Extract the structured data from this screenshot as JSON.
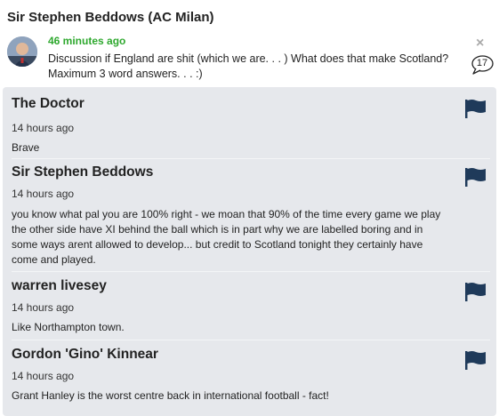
{
  "post": {
    "author": "Sir Stephen Beddows (AC Milan)",
    "time": "46 minutes ago",
    "text": "Discussion if England are shit (which we are. . . ) What does that make Scotland? Maximum 3 word answers. . . :)",
    "close_icon": "×",
    "comment_count": "17"
  },
  "replies": [
    {
      "name": "The Doctor",
      "time": "14 hours ago",
      "text": "Brave"
    },
    {
      "name": "Sir Stephen Beddows",
      "time": "14 hours ago",
      "text": "you know what pal you are 100% right - we moan that 90% of the time every game we play the other side have XI behind the ball which is in part why we are labelled boring and in some ways arent allowed to develop... but credit to Scotland tonight they certainly have come and played."
    },
    {
      "name": "warren livesey",
      "time": "14 hours ago",
      "text": "Like Northampton town."
    },
    {
      "name": "Gordon 'Gino' Kinnear",
      "time": "14 hours ago",
      "text": "Grant Hanley is the worst centre back in international football - fact!"
    }
  ],
  "icons": {
    "avatar": "avatar",
    "close": "close-icon",
    "comment": "speech-bubble-icon",
    "flag": "flag-icon"
  },
  "colors": {
    "time_green": "#2ea82e",
    "panel_bg": "#e6e8ec",
    "flag": "#1f3a5a"
  }
}
